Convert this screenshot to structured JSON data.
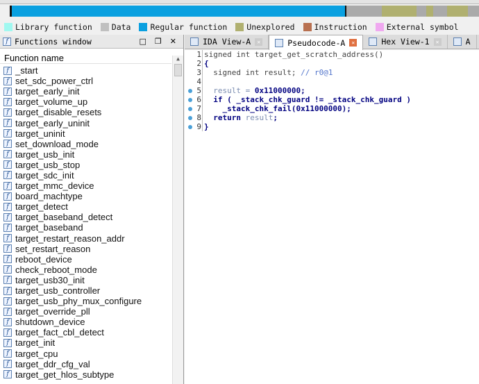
{
  "legend": [
    {
      "label": "Library function",
      "color": "#a0f8f0"
    },
    {
      "label": "Data",
      "color": "#c0c0c0"
    },
    {
      "label": "Regular function",
      "color": "#0aa0e0"
    },
    {
      "label": "Unexplored",
      "color": "#b0b070"
    },
    {
      "label": "Instruction",
      "color": "#b87050"
    },
    {
      "label": "External symbol",
      "color": "#f0a8f0"
    }
  ],
  "functions_window": {
    "title": "Functions window",
    "column_header": "Function name",
    "items": [
      "_start",
      "set_sdc_power_ctrl",
      "target_early_init",
      "target_volume_up",
      "target_disable_resets",
      "target_early_uninit",
      "target_uninit",
      "set_download_mode",
      "target_usb_init",
      "target_usb_stop",
      "target_sdc_init",
      "target_mmc_device",
      "board_machtype",
      "target_detect",
      "target_baseband_detect",
      "target_baseband",
      "target_restart_reason_addr",
      "set_restart_reason",
      "reboot_device",
      "check_reboot_mode",
      "target_usb30_init",
      "target_usb_controller",
      "target_usb_phy_mux_configure",
      "target_override_pll",
      "shutdown_device",
      "target_fact_cbl_detect",
      "target_init",
      "target_cpu",
      "target_ddr_cfg_val",
      "target_get_hlos_subtype"
    ]
  },
  "tabs": [
    {
      "label": "IDA View-A"
    },
    {
      "label": "Pseudocode-A",
      "active": true
    },
    {
      "label": "Hex View-1"
    },
    {
      "label": "A"
    }
  ],
  "code": {
    "line1": "signed int target_get_scratch_address()",
    "line2": "{",
    "line3a": "  signed int result; ",
    "line3b": "// r0@1",
    "line5a": "  result = ",
    "line5b": "0x11000000;",
    "line6": "  if ( _stack_chk_guard != _stack_chk_guard )",
    "line7": "    _stack_chk_fail(0x11000000);",
    "line8a": "  return ",
    "line8b": "result",
    ";": ";",
    "line9": "}"
  }
}
